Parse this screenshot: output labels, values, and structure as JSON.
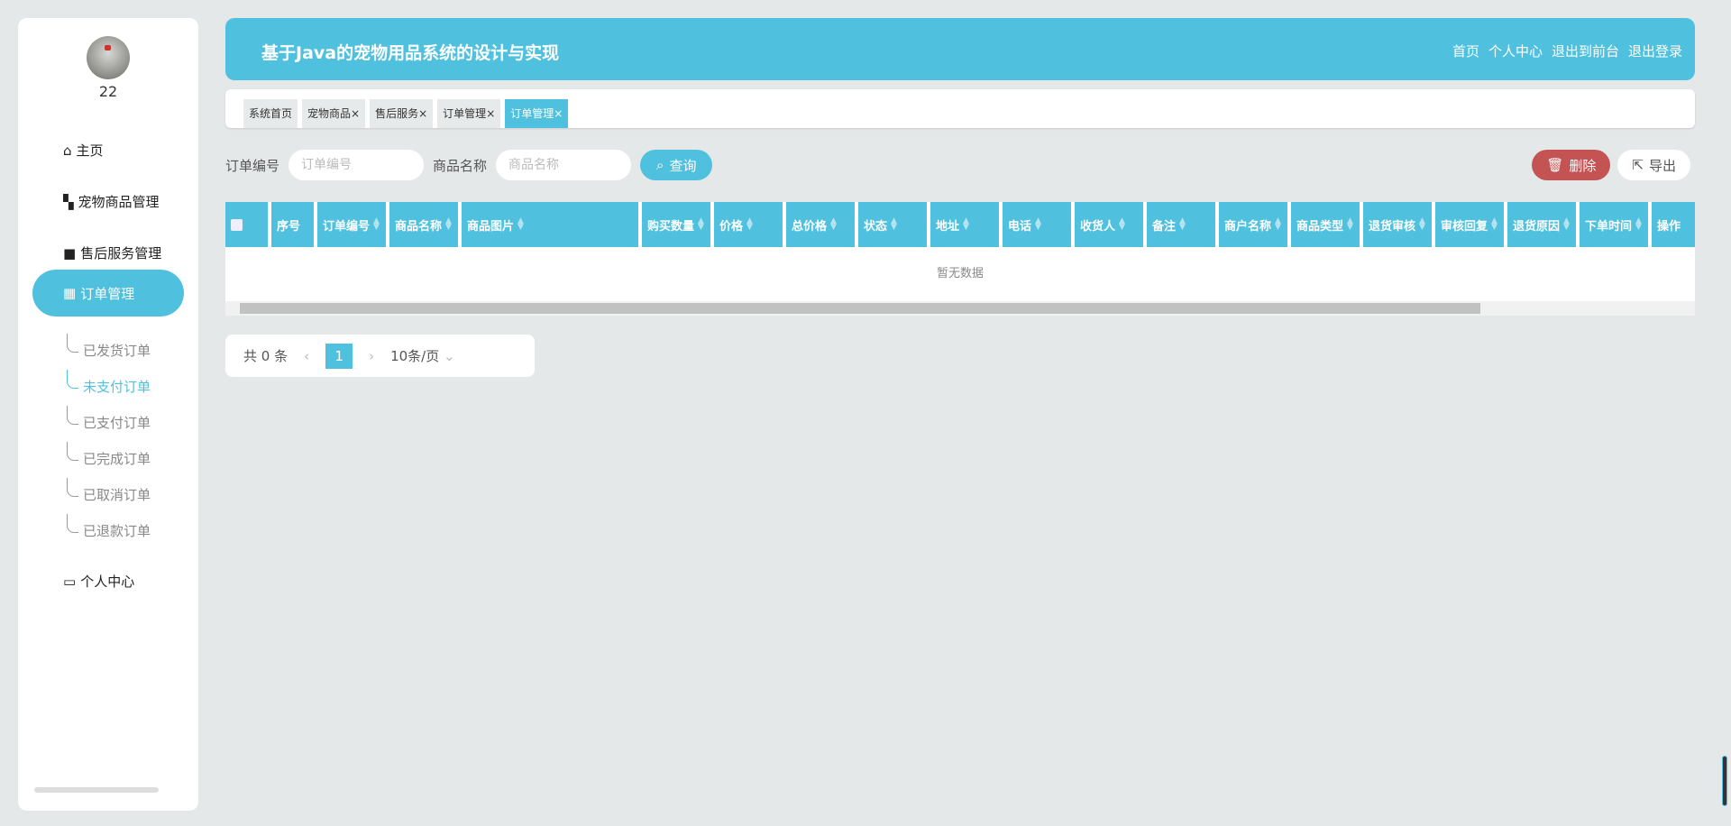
{
  "sidebar": {
    "username": "22",
    "items": [
      {
        "label": "主页",
        "icon": "home-icon"
      },
      {
        "label": "宠物商品管理",
        "icon": "grid-icon"
      },
      {
        "label": "售后服务管理",
        "icon": "wallet-icon"
      },
      {
        "label": "订单管理",
        "icon": "table-icon",
        "active": true
      },
      {
        "label": "个人中心",
        "icon": "card-icon"
      }
    ],
    "subitems": [
      "已发货订单",
      "未支付订单",
      "已支付订单",
      "已完成订单",
      "已取消订单",
      "已退款订单"
    ]
  },
  "header": {
    "title": "基于Java的宠物用品系统的设计与实现",
    "links": [
      "首页",
      "个人中心",
      "退出到前台",
      "退出登录"
    ]
  },
  "tabs": [
    "系统首页",
    "宠物商品",
    "售后服务",
    "订单管理",
    "订单管理"
  ],
  "search": {
    "order_label": "订单编号",
    "order_placeholder": "订单编号",
    "goods_label": "商品名称",
    "goods_placeholder": "商品名称",
    "query": "查询"
  },
  "actions": {
    "delete": "删除",
    "export": "导出"
  },
  "table": {
    "columns": [
      "序号",
      "订单编号",
      "商品名称",
      "商品图片",
      "购买数量",
      "价格",
      "总价格",
      "状态",
      "地址",
      "电话",
      "收货人",
      "备注",
      "商户名称",
      "商品类型",
      "退货审核",
      "审核回复",
      "退货原因",
      "下单时间",
      "操作"
    ],
    "empty": "暂无数据"
  },
  "pagination": {
    "total": "共 0 条",
    "page": "1",
    "size": "10条/页"
  },
  "colors": {
    "accent": "#4fc1df",
    "danger": "#c45353"
  }
}
